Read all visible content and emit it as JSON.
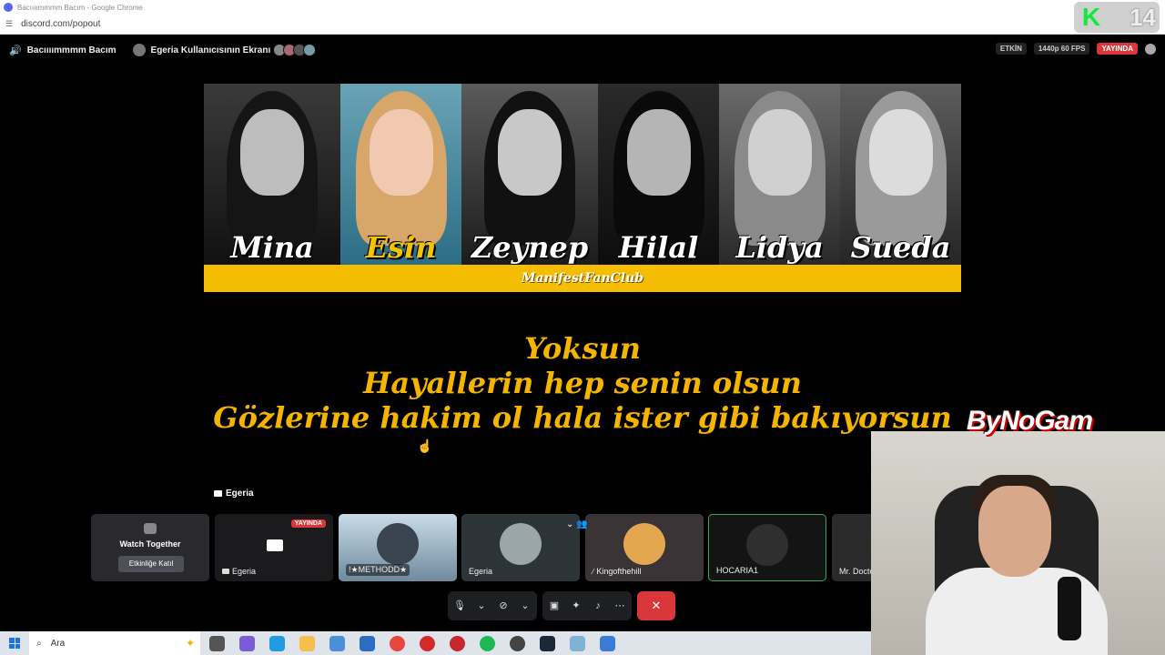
{
  "browser": {
    "window_title": "Bacıııımmmm Bacım - Google Chrome",
    "url": "discord.com/popout"
  },
  "overlay_badge": {
    "number": "14"
  },
  "discord": {
    "channel_name": "Bacıııımmmm Bacım",
    "screen_title": "Egeria Kullanıcısının Ekranı",
    "etkin_label": "ETKİN",
    "quality_label": "1440p 60 FPS",
    "live_label": "YAYINDA"
  },
  "banner": {
    "names": [
      "Mina",
      "Esin",
      "Zeynep",
      "Hilal",
      "Lidya",
      "Sueda"
    ],
    "footer": "ManifestFanClub"
  },
  "lyrics": [
    "Yoksun",
    "Hayallerin hep senin olsun",
    "Gözlerine hakim ol hala ister gibi bakıyorsun"
  ],
  "participants": {
    "label": "Egeria",
    "watch_together_title": "Watch Together",
    "watch_together_button": "Etkinliğe Katıl",
    "tiles": [
      {
        "name": "Egeria",
        "badge": "YAYINDA"
      },
      {
        "name": "!★METHODD★"
      },
      {
        "name": "Egeria"
      },
      {
        "name": "Kingofthehill"
      },
      {
        "name": "HOCARIA1"
      },
      {
        "name": "Mr. Docto"
      }
    ]
  },
  "webcam": {
    "brand": "ByNoGam"
  },
  "taskbar": {
    "search_placeholder": "Ara"
  },
  "colors": {
    "banner_gold": "#f5bd02",
    "lyrics_gold": "#f5b400",
    "live_red": "#da373c",
    "discord_dark": "#1e1f22"
  }
}
